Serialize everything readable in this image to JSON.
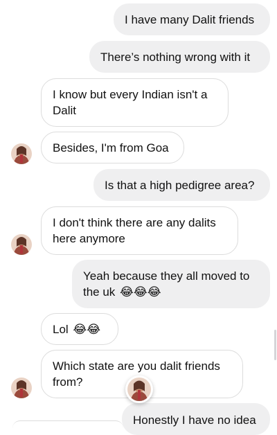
{
  "conversation": {
    "messages": [
      {
        "sender": "me",
        "text": "I have many Dalit friends"
      },
      {
        "sender": "me",
        "text": "There’s nothing wrong with it"
      },
      {
        "sender": "them",
        "text": "I know but every Indian isn't a Dalit"
      },
      {
        "sender": "them",
        "text": "Besides, I'm from Goa"
      },
      {
        "sender": "me",
        "text": "Is that a high pedigree area?"
      },
      {
        "sender": "them",
        "text": "I don't think there are any dalits here anymore"
      },
      {
        "sender": "me",
        "text": "Yeah because they all moved to the uk",
        "emoji": "😂😂😂"
      },
      {
        "sender": "them",
        "text": "Lol",
        "emoji": "😂😂"
      },
      {
        "sender": "them",
        "text": "Which state are you dalit friends from?"
      },
      {
        "sender": "me",
        "text": "Honestly I have no idea"
      }
    ]
  },
  "colors": {
    "outgoing_bubble": "#efeff0",
    "incoming_bubble_border": "#dcdcdc",
    "text": "#111111",
    "background": "#ffffff"
  },
  "icons": {
    "sender_avatar": "profile-photo-avatar",
    "seen_indicator": "seen-avatar",
    "emoji": "face-with-tears-of-joy"
  }
}
